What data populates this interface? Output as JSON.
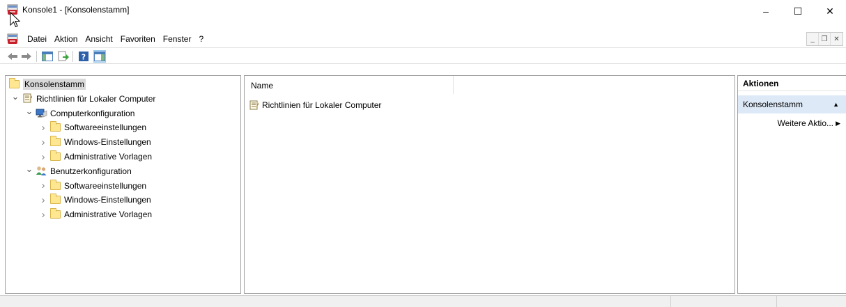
{
  "window": {
    "title": "Konsole1 - [Konsolenstamm]",
    "controls": {
      "minimize": "–",
      "maximize": "☐",
      "close": "✕"
    }
  },
  "menu": {
    "items": [
      "Datei",
      "Aktion",
      "Ansicht",
      "Favoriten",
      "Fenster",
      "?"
    ],
    "mdi_controls": {
      "minimize": "_",
      "restore": "❐",
      "close": "✕"
    }
  },
  "toolbar": {
    "buttons": [
      "back-arrow-icon",
      "forward-arrow-icon",
      "show-hide-tree-icon",
      "export-list-icon",
      "help-icon",
      "show-hide-action-pane-icon"
    ]
  },
  "tree": {
    "items": [
      {
        "label": "Konsolenstamm",
        "icon": "folder-icon",
        "level": 0,
        "expander": "",
        "selected": true
      },
      {
        "label": "Richtlinien für Lokaler Computer",
        "icon": "policy-icon",
        "level": 1,
        "expander": "expanded"
      },
      {
        "label": "Computerkonfiguration",
        "icon": "computer-icon",
        "level": 2,
        "expander": "expanded"
      },
      {
        "label": "Softwareeinstellungen",
        "icon": "folder-icon",
        "level": 3,
        "expander": "collapsed"
      },
      {
        "label": "Windows-Einstellungen",
        "icon": "folder-icon",
        "level": 3,
        "expander": "collapsed"
      },
      {
        "label": "Administrative Vorlagen",
        "icon": "folder-icon",
        "level": 3,
        "expander": "collapsed"
      },
      {
        "label": "Benutzerkonfiguration",
        "icon": "users-icon",
        "level": 2,
        "expander": "expanded"
      },
      {
        "label": "Softwareeinstellungen",
        "icon": "folder-icon",
        "level": 3,
        "expander": "collapsed"
      },
      {
        "label": "Windows-Einstellungen",
        "icon": "folder-icon",
        "level": 3,
        "expander": "collapsed"
      },
      {
        "label": "Administrative Vorlagen",
        "icon": "folder-icon",
        "level": 3,
        "expander": "collapsed"
      }
    ]
  },
  "list": {
    "columns": [
      "Name"
    ],
    "rows": [
      {
        "name": "Richtlinien für Lokaler Computer",
        "icon": "policy-icon"
      }
    ]
  },
  "actions": {
    "header": "Aktionen",
    "section": "Konsolenstamm",
    "items": [
      "Weitere Aktio..."
    ]
  },
  "colors": {
    "selection": "#d9d9d9",
    "action_section": "#dde9f6",
    "pressed_toolbar": "#cce4f7"
  }
}
